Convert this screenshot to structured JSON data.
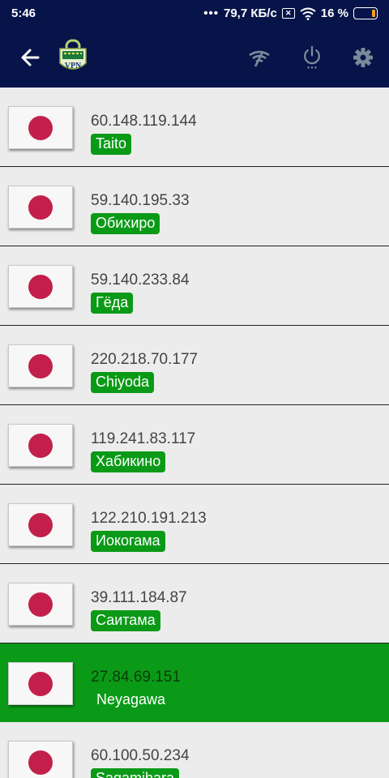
{
  "status_bar": {
    "time": "5:46",
    "dots": "•••",
    "network_speed": "79,7 КБ/с",
    "battery_percent": "16 %"
  },
  "toolbar": {
    "logo_text": "VPN"
  },
  "servers": [
    {
      "ip": "60.148.119.144",
      "city": "Taito"
    },
    {
      "ip": "59.140.195.33",
      "city": "Обихиро"
    },
    {
      "ip": "59.140.233.84",
      "city": "Гёда"
    },
    {
      "ip": "220.218.70.177",
      "city": "Chiyoda"
    },
    {
      "ip": "119.241.83.117",
      "city": "Хабикино"
    },
    {
      "ip": "122.210.191.213",
      "city": "Иокогама"
    },
    {
      "ip": "39.111.184.87",
      "city": "Саитама"
    },
    {
      "ip": "27.84.69.151",
      "city": "Neyagawa",
      "selected": true
    },
    {
      "ip": "60.100.50.234",
      "city": "Sagamihara"
    }
  ],
  "colors": {
    "header": "#07144a",
    "badge": "#0b9a17",
    "flag_disc": "#c2204a"
  }
}
